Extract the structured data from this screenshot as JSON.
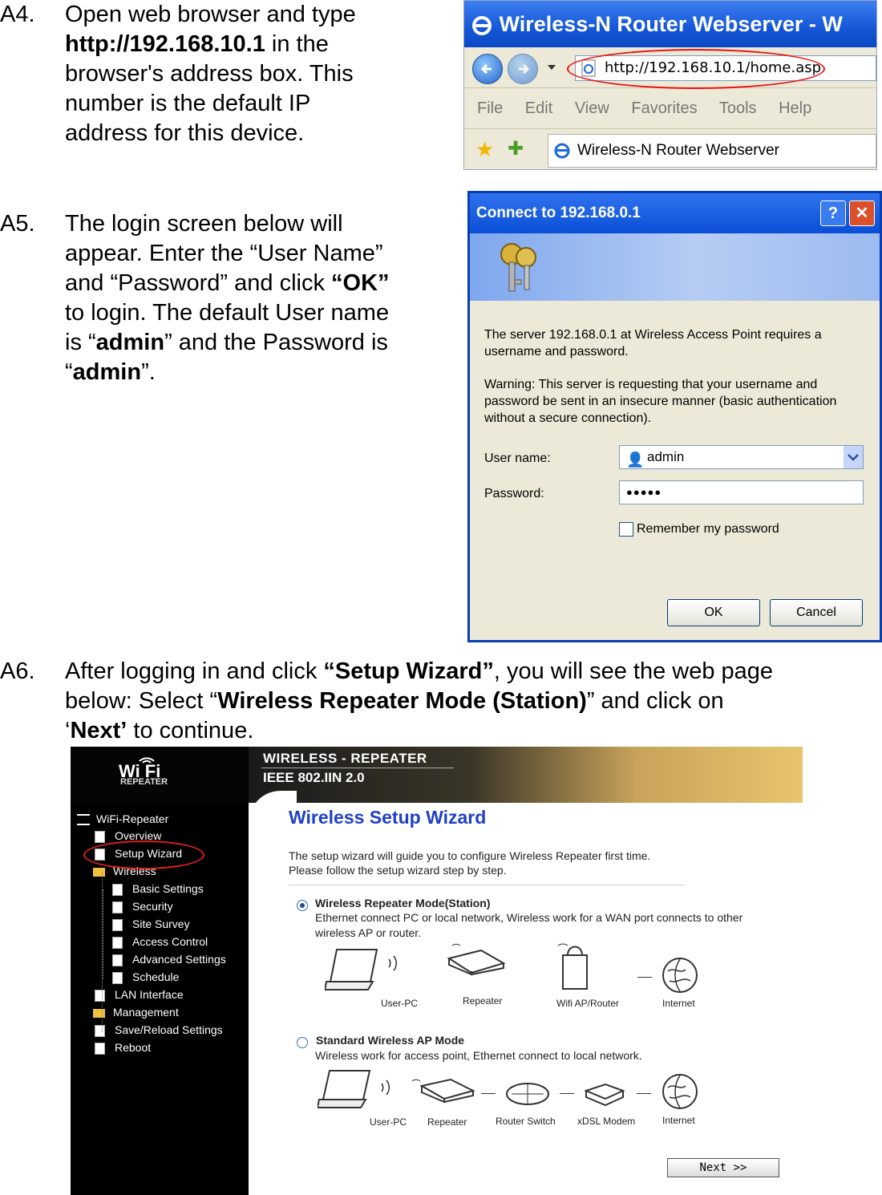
{
  "step_a4": {
    "num": "A4.",
    "line1_pre": "Open web browser and type",
    "url_bold": "http://192.168.10.1",
    "line2_post": " in the",
    "line3": "browser's address box. This",
    "line4": "number is the default IP",
    "line5": "address for this device."
  },
  "browser": {
    "title": "Wireless-N Router Webserver - W",
    "address": "http://192.168.10.1/home.asp",
    "menu": [
      "File",
      "Edit",
      "View",
      "Favorites",
      "Tools",
      "Help"
    ],
    "tab_title": "Wireless-N Router Webserver"
  },
  "step_a5": {
    "num": "A5.",
    "line1": "The login screen below will",
    "line2": "appear. Enter the “User Name”",
    "line3_pre": "and “Password” and click ",
    "line3_bold": "“OK”",
    "line4": "to login. The default User name",
    "line5_pre": "is “",
    "line5_bold": "admin",
    "line5_post": "” and the Password is",
    "line6_pre": "“",
    "line6_bold": "admin",
    "line6_post": "”."
  },
  "dialog": {
    "title": "Connect to 192.168.0.1",
    "help": "?",
    "close": "✕",
    "msg1": "The server 192.168.0.1 at Wireless Access Point requires a username and password.",
    "msg2": "Warning: This server is requesting that your username and password be sent in an insecure manner (basic authentication without a secure connection).",
    "user_label": "User name:",
    "user_value": "admin",
    "pass_label": "Password:",
    "pass_value": "●●●●●",
    "remember": "Remember my password",
    "ok": "OK",
    "cancel": "Cancel"
  },
  "step_a6": {
    "num": "A6.",
    "l1_pre": "After logging in and click ",
    "l1_bold": "“Setup Wizard”",
    "l1_post": ", you will see the web page",
    "l2_pre": "below:   Select “",
    "l2_bold": "Wireless Repeater Mode (Station)",
    "l2_post": "” and click on",
    "l3_pre": "‘",
    "l3_bold": "Next’",
    "l3_post": " to continue."
  },
  "web": {
    "logo": "Wi  Fi",
    "logo_sub": "REPEATER",
    "header1": "WIRELESS - REPEATER",
    "header2": "IEEE 802.IIN 2.0",
    "tree": {
      "root": "WiFi-Repeater",
      "overview": "Overview",
      "setup": "Setup Wizard",
      "wireless": "Wireless",
      "basic": "Basic Settings",
      "security": "Security",
      "survey": "Site Survey",
      "access": "Access Control",
      "advanced": "Advanced Settings",
      "schedule": "Schedule",
      "lan": "LAN Interface",
      "management": "Management",
      "save": "Save/Reload Settings",
      "reboot": "Reboot"
    },
    "title": "Wireless Setup Wizard",
    "intro1": "The setup wizard will guide you to configure Wireless Repeater first time.",
    "intro2": "Please follow the setup wizard step by step.",
    "opt1_title": "Wireless Repeater Mode(Station)",
    "opt1_desc1": "Ethernet connect PC or local network, Wireless work for a WAN port connects to other",
    "opt1_desc2": "wireless AP or router.",
    "opt1_devices": [
      "User-PC",
      "Repeater",
      "Wifi AP/Router",
      "Internet"
    ],
    "opt2_title": "Standard Wireless AP Mode",
    "opt2_desc": "Wireless work for access point, Ethernet connect to local network.",
    "opt2_devices": [
      "User-PC",
      "Repeater",
      "Router Switch",
      "xDSL Modem",
      "Internet"
    ],
    "next": "Next >>"
  }
}
